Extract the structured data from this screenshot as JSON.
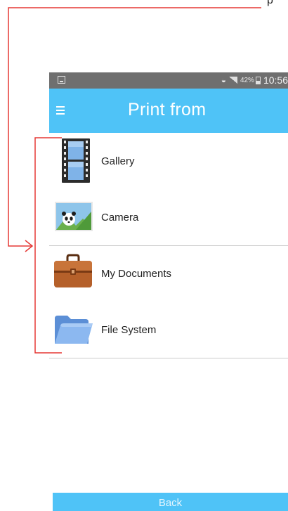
{
  "top_crop_text": "p",
  "status_bar": {
    "battery_percent": "42%",
    "time": "10:56"
  },
  "app_bar": {
    "title": "Print from",
    "menu_icon": "hamburger-menu-icon"
  },
  "sources": [
    {
      "label": "Gallery",
      "icon": "film-strip-icon"
    },
    {
      "label": "Camera",
      "icon": "panda-photo-icon"
    },
    {
      "label": "My Documents",
      "icon": "briefcase-icon"
    },
    {
      "label": "File System",
      "icon": "folder-icon"
    }
  ],
  "back_label": "Back",
  "colors": {
    "accent": "#4fc3f7",
    "status_bar": "#6f6f6f",
    "annotation": "#e53935"
  }
}
